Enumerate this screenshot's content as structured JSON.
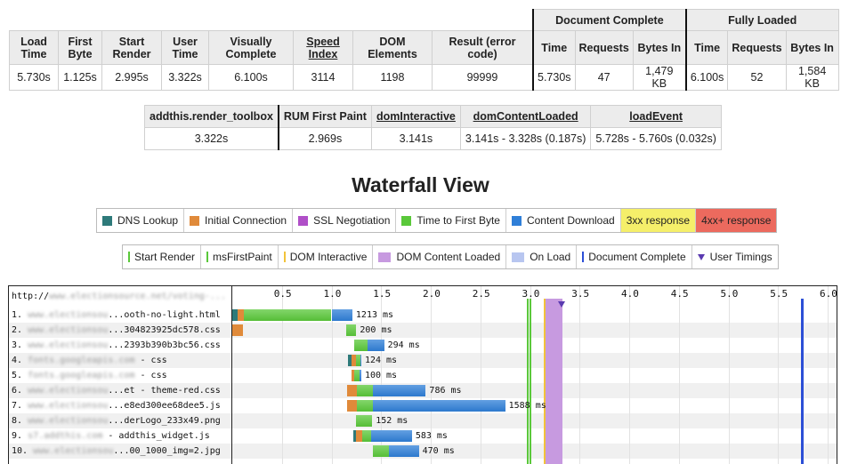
{
  "summary": {
    "groups": {
      "doc_complete": "Document Complete",
      "fully_loaded": "Fully Loaded"
    },
    "headers": [
      "Load Time",
      "First Byte",
      "Start Render",
      "User Time",
      "Visually Complete",
      "Speed Index",
      "DOM Elements",
      "Result (error code)",
      "Time",
      "Requests",
      "Bytes In",
      "Time",
      "Requests",
      "Bytes In"
    ],
    "values": [
      "5.730s",
      "1.125s",
      "2.995s",
      "3.322s",
      "6.100s",
      "3114",
      "1198",
      "99999",
      "5.730s",
      "47",
      "1,479 KB",
      "6.100s",
      "52",
      "1,584 KB"
    ]
  },
  "timing": {
    "headers": [
      "addthis.render_toolbox",
      "RUM First Paint",
      "domInteractive",
      "domContentLoaded",
      "loadEvent"
    ],
    "values": [
      "3.322s",
      "2.969s",
      "3.141s",
      "3.141s - 3.328s (0.187s)",
      "5.728s - 5.760s (0.032s)"
    ]
  },
  "waterfall_title": "Waterfall View",
  "legend_requests": [
    {
      "label": "DNS Lookup",
      "color": "#2e7a7a"
    },
    {
      "label": "Initial Connection",
      "color": "#e08a3a"
    },
    {
      "label": "SSL Negotiation",
      "color": "#b04fc8"
    },
    {
      "label": "Time to First Byte",
      "color": "#5ac83a"
    },
    {
      "label": "Content Download",
      "color": "#2f7fd8"
    },
    {
      "label": "3xx response",
      "color": "#f5ef6a"
    },
    {
      "label": "4xx+ response",
      "color": "#ec6a5e"
    }
  ],
  "legend_events": [
    {
      "label": "Start Render",
      "color": "#5ac83a",
      "kind": "line"
    },
    {
      "label": "msFirstPaint",
      "color": "#5ac83a",
      "kind": "line"
    },
    {
      "label": "DOM Interactive",
      "color": "#f2c33a",
      "kind": "line"
    },
    {
      "label": "DOM Content Loaded",
      "color": "#c79ae0",
      "kind": "box"
    },
    {
      "label": "On Load",
      "color": "#b8c6f0",
      "kind": "box"
    },
    {
      "label": "Document Complete",
      "color": "#2c4fd6",
      "kind": "line"
    },
    {
      "label": "User Timings",
      "color": "#5a3ab0",
      "kind": "tri"
    }
  ],
  "waterfall": {
    "page_url_prefix": "http://",
    "page_url_blurred": "www.electionsource.net/voting-...",
    "ticks": [
      "0.5",
      "1.0",
      "1.5",
      "2.0",
      "2.5",
      "3.0",
      "3.5",
      "4.0",
      "4.5",
      "5.0",
      "5.5",
      "6.0"
    ],
    "rows": [
      {
        "num": "1.",
        "host": "www.electionsou",
        "path": "...ooth-no-light.html",
        "dur": "1213 ms",
        "segs": [
          {
            "s": 0.0,
            "e": 0.05,
            "c": "#2e7a7a"
          },
          {
            "s": 0.05,
            "e": 0.12,
            "c": "#e08a3a"
          },
          {
            "s": 0.12,
            "e": 1.0,
            "c": "#5ac83a"
          },
          {
            "s": 1.0,
            "e": 1.21,
            "c": "#2f7fd8"
          }
        ]
      },
      {
        "num": "2.",
        "host": "www.electionsou",
        "path": "...304823925dc578.css",
        "dur": "200 ms",
        "segs": [
          {
            "s": 0.0,
            "e": 0.11,
            "c": "#e08a3a"
          },
          {
            "s": 1.15,
            "e": 1.25,
            "c": "#5ac83a"
          }
        ]
      },
      {
        "num": "3.",
        "host": "www.electionsou",
        "path": "...2393b390b3bc56.css",
        "dur": "294 ms",
        "segs": [
          {
            "s": 1.23,
            "e": 1.36,
            "c": "#5ac83a"
          },
          {
            "s": 1.36,
            "e": 1.53,
            "c": "#2f7fd8"
          }
        ]
      },
      {
        "num": "4.",
        "host": "fonts.googleapis.com",
        "path": " - css",
        "dur": "124 ms",
        "segs": [
          {
            "s": 1.17,
            "e": 1.2,
            "c": "#2e7a7a"
          },
          {
            "s": 1.2,
            "e": 1.25,
            "c": "#e08a3a"
          },
          {
            "s": 1.25,
            "e": 1.29,
            "c": "#5ac83a"
          },
          {
            "s": 1.29,
            "e": 1.3,
            "c": "#2f7fd8"
          }
        ]
      },
      {
        "num": "5.",
        "host": "fonts.googleapis.com",
        "path": " - css",
        "dur": "100 ms",
        "segs": [
          {
            "s": 1.2,
            "e": 1.23,
            "c": "#e08a3a"
          },
          {
            "s": 1.23,
            "e": 1.28,
            "c": "#5ac83a"
          },
          {
            "s": 1.28,
            "e": 1.3,
            "c": "#2f7fd8"
          }
        ]
      },
      {
        "num": "6.",
        "host": "www.electionsou",
        "path": "...et - theme-red.css",
        "dur": "786 ms",
        "segs": [
          {
            "s": 1.16,
            "e": 1.26,
            "c": "#e08a3a"
          },
          {
            "s": 1.26,
            "e": 1.42,
            "c": "#5ac83a"
          },
          {
            "s": 1.42,
            "e": 1.95,
            "c": "#2f7fd8"
          }
        ]
      },
      {
        "num": "7.",
        "host": "www.electionsou",
        "path": "...e8ed300ee68dee5.js",
        "dur": "1588 ms",
        "segs": [
          {
            "s": 1.16,
            "e": 1.26,
            "c": "#e08a3a"
          },
          {
            "s": 1.26,
            "e": 1.42,
            "c": "#5ac83a"
          },
          {
            "s": 1.42,
            "e": 2.75,
            "c": "#2f7fd8"
          }
        ]
      },
      {
        "num": "8.",
        "host": "www.electionsou",
        "path": "...derLogo_233x49.png",
        "dur": "152 ms",
        "segs": [
          {
            "s": 1.25,
            "e": 1.41,
            "c": "#5ac83a"
          }
        ]
      },
      {
        "num": "9.",
        "host": "s7.addthis.com",
        "path": " - addthis_widget.js",
        "dur": "583 ms",
        "segs": [
          {
            "s": 1.22,
            "e": 1.25,
            "c": "#2e7a7a"
          },
          {
            "s": 1.25,
            "e": 1.31,
            "c": "#e08a3a"
          },
          {
            "s": 1.31,
            "e": 1.4,
            "c": "#5ac83a"
          },
          {
            "s": 1.4,
            "e": 1.81,
            "c": "#2f7fd8"
          }
        ]
      },
      {
        "num": "10.",
        "host": "www.electionsou",
        "path": "...00_1000_img=2.jpg",
        "dur": "470 ms",
        "segs": [
          {
            "s": 1.42,
            "e": 1.58,
            "c": "#5ac83a"
          },
          {
            "s": 1.58,
            "e": 1.88,
            "c": "#2f7fd8"
          }
        ]
      }
    ],
    "events": {
      "start_render": 2.995,
      "first_paint": 2.969,
      "dom_interactive": 3.141,
      "dcl_start": 3.141,
      "dcl_end": 3.328,
      "user_timing": 3.322,
      "doc_complete": 5.73
    }
  }
}
